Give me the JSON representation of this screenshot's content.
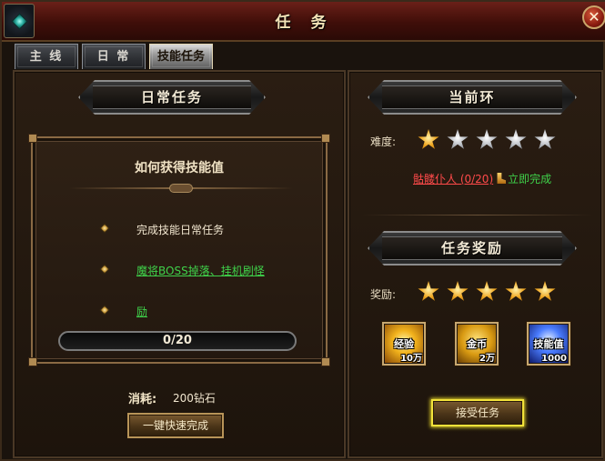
{
  "window": {
    "title": "任 务",
    "close_label": "✕"
  },
  "tabs": [
    {
      "label": "主 线",
      "active": false
    },
    {
      "label": "日 常",
      "active": false
    },
    {
      "label": "技能任务",
      "active": true
    }
  ],
  "left": {
    "banner": "日常任务",
    "info_title": "如何获得技能值",
    "rows": [
      {
        "text": "完成技能日常任务",
        "link": false
      },
      {
        "text": "魔将BOSS掉落、挂机刷怪",
        "link": true
      },
      {
        "text": "励",
        "link": true
      }
    ],
    "progress": {
      "text": "0/20",
      "value": 0,
      "max": 20
    },
    "cost_label": "消耗:",
    "cost_value": "200钻石",
    "quick_complete_button": "一键快速完成"
  },
  "right": {
    "current_banner": "当前环",
    "difficulty_label": "难度:",
    "difficulty_stars": {
      "filled": 1,
      "total": 5
    },
    "target": {
      "name": "骷髅仆人 (0/20)",
      "complete_link": "立即完成"
    },
    "reward_banner": "任务奖励",
    "reward_label": "奖励:",
    "reward_stars": {
      "filled": 5,
      "total": 5
    },
    "rewards": [
      {
        "name": "经验",
        "qty": "10万",
        "icon": "exp-icon"
      },
      {
        "name": "金币",
        "qty": "2万",
        "icon": "gold-coin-icon"
      },
      {
        "name": "技能值",
        "qty": "1000",
        "icon": "skill-points-icon"
      }
    ],
    "accept_button": "接受任务"
  },
  "colors": {
    "title_bar": "#3f0e09",
    "accent_gold": "#b89458",
    "link_green": "#3fd14a",
    "target_red": "#ff4a4a",
    "glow_yellow": "#f2e23a"
  }
}
